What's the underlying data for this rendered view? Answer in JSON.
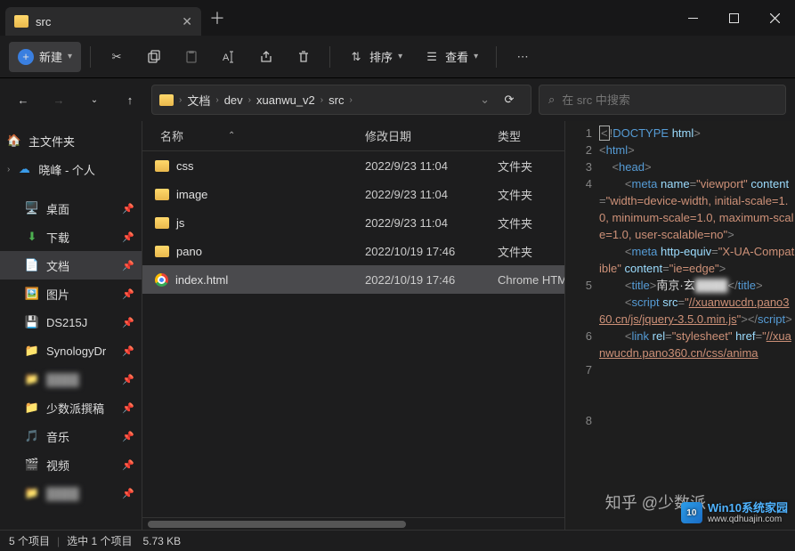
{
  "window": {
    "tab_title": "src"
  },
  "toolbar": {
    "new_label": "新建",
    "sort_label": "排序",
    "view_label": "查看"
  },
  "nav": {
    "breadcrumbs": [
      "文档",
      "dev",
      "xuanwu_v2",
      "src"
    ],
    "search_placeholder": "在 src 中搜索"
  },
  "sidebar": {
    "home": "主文件夹",
    "personal": "晓峰 - 个人",
    "quick": [
      {
        "icon": "🖥️",
        "label": "桌面"
      },
      {
        "icon": "⬇",
        "label": "下载",
        "iconColor": "#4caf50"
      },
      {
        "icon": "📄",
        "label": "文档",
        "active": true
      },
      {
        "icon": "🖼️",
        "label": "图片"
      },
      {
        "icon": "💾",
        "label": "DS215J"
      },
      {
        "icon": "📁",
        "label": "SynologyDr"
      },
      {
        "icon": "📁",
        "label": "",
        "blur": true
      },
      {
        "icon": "📁",
        "label": "少数派撰稿"
      },
      {
        "icon": "🎵",
        "label": "音乐",
        "iconColor": "#e91e63"
      },
      {
        "icon": "🎬",
        "label": "视频"
      },
      {
        "icon": "📁",
        "label": "",
        "blur": true
      }
    ]
  },
  "columns": {
    "name": "名称",
    "date": "修改日期",
    "type": "类型"
  },
  "files": [
    {
      "kind": "folder",
      "name": "css",
      "date": "2022/9/23 11:04",
      "type": "文件夹"
    },
    {
      "kind": "folder",
      "name": "image",
      "date": "2022/9/23 11:04",
      "type": "文件夹"
    },
    {
      "kind": "folder",
      "name": "js",
      "date": "2022/9/23 11:04",
      "type": "文件夹"
    },
    {
      "kind": "folder",
      "name": "pano",
      "date": "2022/10/19 17:46",
      "type": "文件夹"
    },
    {
      "kind": "html",
      "name": "index.html",
      "date": "2022/10/19 17:46",
      "type": "Chrome HTML",
      "selected": true
    }
  ],
  "status": {
    "count": "5 个项目",
    "selected": "选中 1 个项目",
    "size": "5.73 KB"
  },
  "preview": {
    "gutter": [
      "1",
      "2",
      "3",
      "4",
      "",
      "",
      "",
      "",
      "",
      "5",
      "",
      "",
      "6",
      "",
      "7",
      "",
      "",
      "8",
      "",
      "",
      ""
    ],
    "code_raw": "<!DOCTYPE html>\n<html>\n    <head>\n        <meta name=\"viewport\" content=\"width=device-width, initial-scale=1.0, minimum-scale=1.0, maximum-scale=1.0, user-scalable=no\">\n        <meta http-equiv=\"X-UA-Compatible\" content=\"ie=edge\">\n        <title>南京·玄…</title>\n        <script src=\"//xuanwucdn.pano360.cn/js/jquery-3.5.0.min.js\"></script>\n        <link rel=\"stylesheet\" href=\"//xuanwucdn.pano360.cn/css/anima…\">"
  },
  "watermarks": {
    "zhihu": "知乎 @少数派",
    "site": "Win10系统家园",
    "url": "www.qdhuajin.com",
    "badge": "10"
  }
}
